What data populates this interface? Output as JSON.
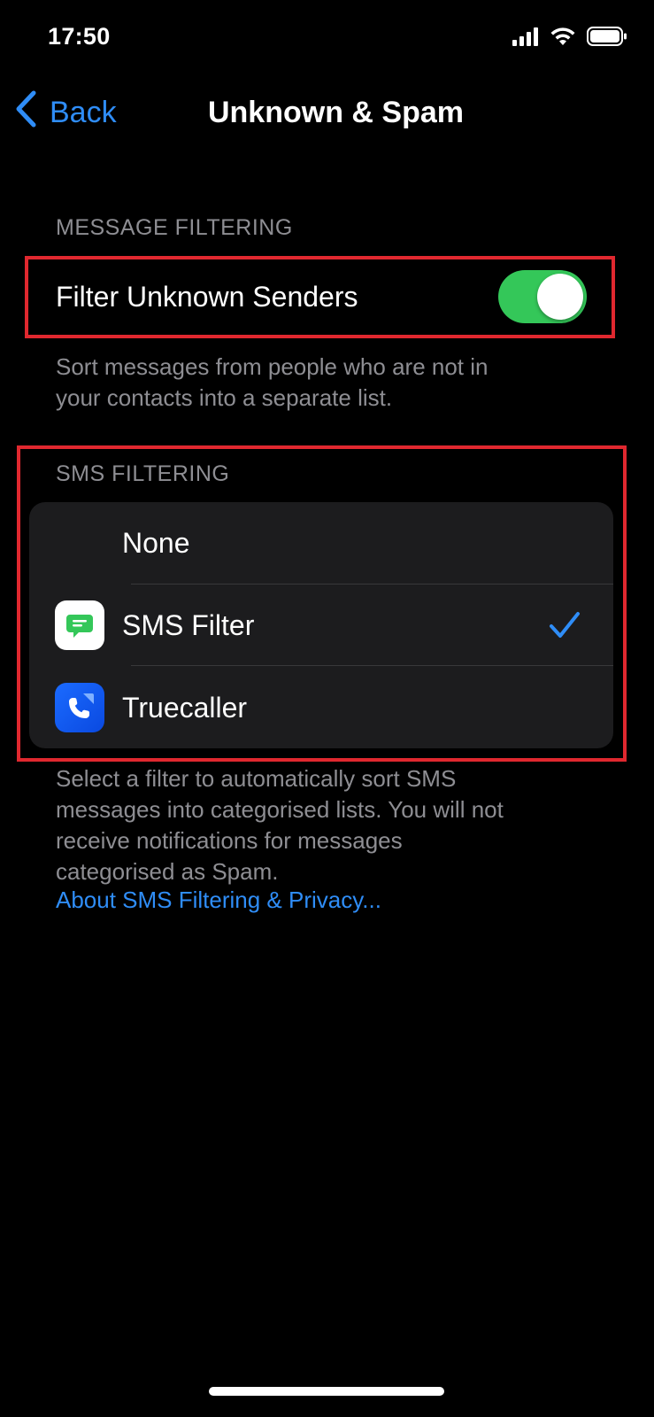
{
  "status_bar": {
    "time": "17:50",
    "icons": [
      "cellular-signal-icon",
      "wifi-icon",
      "battery-icon"
    ]
  },
  "nav": {
    "back_label": "Back",
    "title": "Unknown & Spam"
  },
  "message_filtering": {
    "header": "MESSAGE FILTERING",
    "toggle_label": "Filter Unknown Senders",
    "toggle_on": true,
    "footer": "Sort messages from people who are not in your contacts into a separate list.",
    "footer_lines": [
      "Sort messages from people who are not in",
      "your contacts into a separate list."
    ]
  },
  "sms_filtering": {
    "header": "SMS FILTERING",
    "options": [
      {
        "label": "None",
        "icon": null,
        "selected": false
      },
      {
        "label": "SMS Filter",
        "icon": "sms-filter-app-icon",
        "selected": true
      },
      {
        "label": "Truecaller",
        "icon": "truecaller-app-icon",
        "selected": false
      }
    ],
    "footer_lines": [
      "Select a filter to automatically sort SMS",
      "messages into categorised lists. You will not",
      "receive notifications for messages",
      "categorised as Spam."
    ],
    "link": "About SMS Filtering & Privacy..."
  },
  "colors": {
    "background": "#000000",
    "card": "#1c1c1e",
    "accent_blue": "#2f8df7",
    "toggle_green": "#34c759",
    "secondary_text": "#8e8e93",
    "highlight_red": "#e0282f"
  }
}
